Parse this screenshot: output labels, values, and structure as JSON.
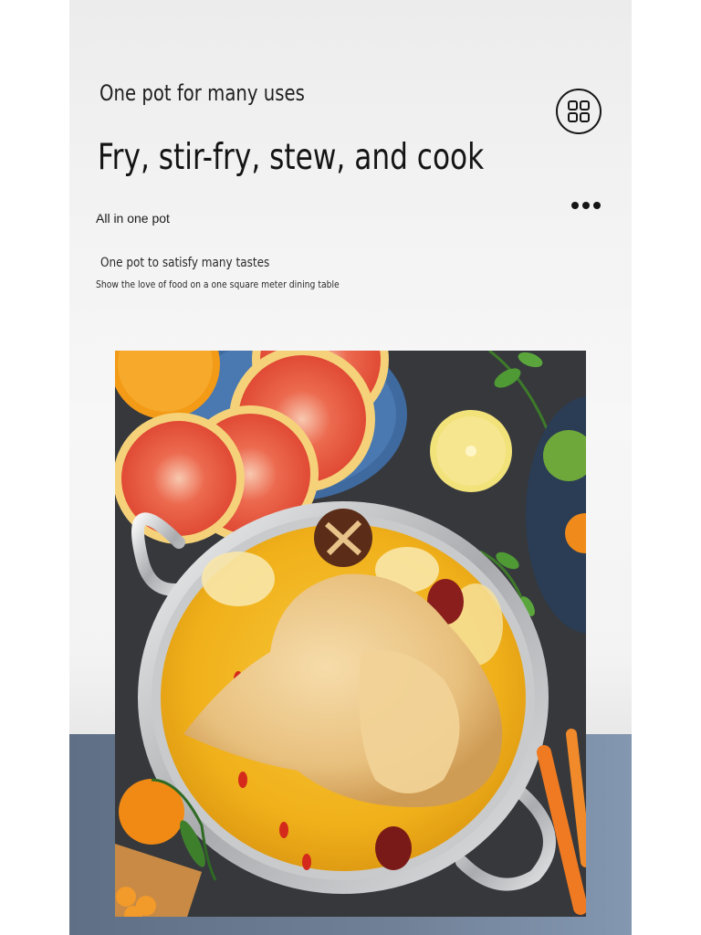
{
  "header": {
    "subtitle": "One pot for many uses",
    "headline": "Fry, stir-fry, stew, and cook",
    "tagline": "All in one pot"
  },
  "intro": {
    "line1": "One pot to satisfy many tastes",
    "line2": "Show the love of food on a one square meter dining table"
  },
  "icons": {
    "menu": "grid-icon",
    "more": "more-dots-icon"
  },
  "colors": {
    "background": "#f3f3f3",
    "band": "#6f7f95",
    "text": "#141414",
    "broth": "#f2b51e"
  }
}
